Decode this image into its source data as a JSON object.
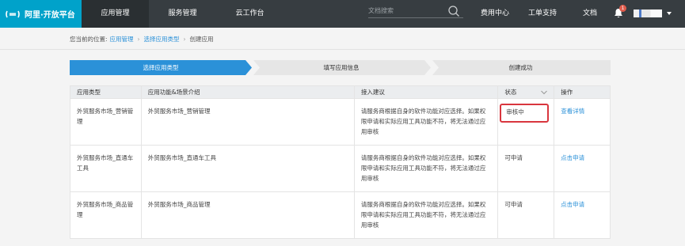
{
  "brand": {
    "name": "阿里·开放平台"
  },
  "nav": {
    "items": [
      {
        "label": "应用管理"
      },
      {
        "label": "服务管理"
      },
      {
        "label": "云工作台"
      }
    ],
    "search_placeholder": "文档搜索",
    "right": [
      {
        "label": "费用中心"
      },
      {
        "label": "工单支持"
      },
      {
        "label": "文档"
      }
    ],
    "notification_count": "1"
  },
  "breadcrumb": {
    "prefix": "您当前的位置:",
    "items": [
      "应用管理",
      "选择应用类型",
      "创建应用"
    ]
  },
  "steps": [
    {
      "label": "选择应用类型",
      "state": "active"
    },
    {
      "label": "填写应用信息",
      "state": "pending"
    },
    {
      "label": "创建成功",
      "state": "pending"
    }
  ],
  "table": {
    "headers": [
      "应用类型",
      "应用功能&场景介绍",
      "接入建议",
      "状态",
      "操作"
    ],
    "rows": [
      {
        "type": "外贸服务市场_营销管理",
        "intro": "外贸服务市场_营销管理",
        "advice": "请服务商根据自身的软件功能对应选择。如果权限申请和实际应用工具功能不符，将无法通过应用审核",
        "status": "审核中",
        "action": "查看详情"
      },
      {
        "type": "外贸服务市场_直通车工具",
        "intro": "外贸服务市场_直通车工具",
        "advice": "请服务商根据自身的软件功能对应选择。如果权限申请和实际应用工具功能不符，将无法通过应用审核",
        "status": "可申请",
        "action": "点击申请"
      },
      {
        "type": "外贸服务市场_商品管理",
        "intro": "外贸服务市场_商品管理",
        "advice": "请服务商根据自身的软件功能对应选择。如果权限申请和实际应用工具功能不符，将无法通过应用审核",
        "status": "可申请",
        "action": "点击申请"
      }
    ]
  },
  "colors": {
    "brand": "#00a2ca",
    "topbar": "#373d41",
    "step_active": "#2b91d8",
    "link": "#2b91d8",
    "highlight": "#d9363e"
  }
}
